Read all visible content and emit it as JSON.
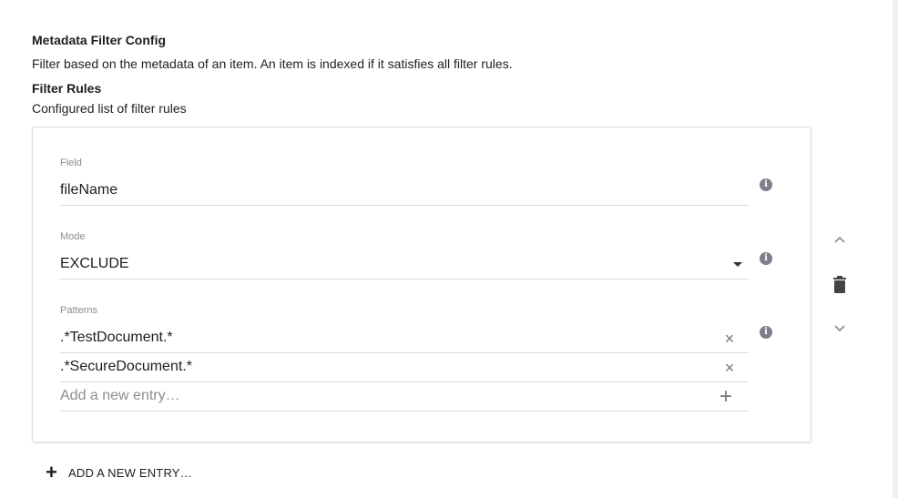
{
  "section": {
    "title": "Metadata Filter Config",
    "description": "Filter based on the metadata of an item. An item is indexed if it satisfies all filter rules."
  },
  "filter_rules": {
    "title": "Filter Rules",
    "description": "Configured list of filter rules"
  },
  "rule": {
    "field": {
      "label": "Field",
      "value": "fileName",
      "info_icon": "info-icon"
    },
    "mode": {
      "label": "Mode",
      "value": "EXCLUDE",
      "dropdown_icon": "caret-down-icon",
      "info_icon": "info-icon"
    },
    "patterns": {
      "label": "Patterns",
      "entries": [
        ".*TestDocument.*",
        ".*SecureDocument.*"
      ],
      "placeholder": "Add a new entry…",
      "clear_icon": "close-icon",
      "add_icon": "plus-icon",
      "info_icon": "info-icon"
    }
  },
  "controls": {
    "move_up_icon": "chevron-up-icon",
    "delete_icon": "trash-icon",
    "move_down_icon": "chevron-down-icon"
  },
  "add_new": {
    "label": "ADD A NEW ENTRY…",
    "icon": "plus-icon"
  },
  "colors": {
    "icon_gray": "#7e7e8a",
    "border": "#dcdcdc",
    "label_gray": "#8d8d8d"
  }
}
